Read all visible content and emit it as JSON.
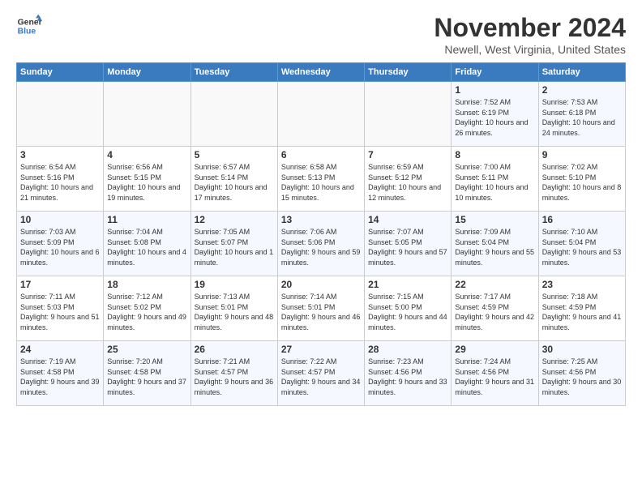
{
  "logo": {
    "line1": "General",
    "line2": "Blue"
  },
  "title": "November 2024",
  "location": "Newell, West Virginia, United States",
  "days_of_week": [
    "Sunday",
    "Monday",
    "Tuesday",
    "Wednesday",
    "Thursday",
    "Friday",
    "Saturday"
  ],
  "weeks": [
    [
      {
        "day": "",
        "info": ""
      },
      {
        "day": "",
        "info": ""
      },
      {
        "day": "",
        "info": ""
      },
      {
        "day": "",
        "info": ""
      },
      {
        "day": "",
        "info": ""
      },
      {
        "day": "1",
        "info": "Sunrise: 7:52 AM\nSunset: 6:19 PM\nDaylight: 10 hours and 26 minutes."
      },
      {
        "day": "2",
        "info": "Sunrise: 7:53 AM\nSunset: 6:18 PM\nDaylight: 10 hours and 24 minutes."
      }
    ],
    [
      {
        "day": "3",
        "info": "Sunrise: 6:54 AM\nSunset: 5:16 PM\nDaylight: 10 hours and 21 minutes."
      },
      {
        "day": "4",
        "info": "Sunrise: 6:56 AM\nSunset: 5:15 PM\nDaylight: 10 hours and 19 minutes."
      },
      {
        "day": "5",
        "info": "Sunrise: 6:57 AM\nSunset: 5:14 PM\nDaylight: 10 hours and 17 minutes."
      },
      {
        "day": "6",
        "info": "Sunrise: 6:58 AM\nSunset: 5:13 PM\nDaylight: 10 hours and 15 minutes."
      },
      {
        "day": "7",
        "info": "Sunrise: 6:59 AM\nSunset: 5:12 PM\nDaylight: 10 hours and 12 minutes."
      },
      {
        "day": "8",
        "info": "Sunrise: 7:00 AM\nSunset: 5:11 PM\nDaylight: 10 hours and 10 minutes."
      },
      {
        "day": "9",
        "info": "Sunrise: 7:02 AM\nSunset: 5:10 PM\nDaylight: 10 hours and 8 minutes."
      }
    ],
    [
      {
        "day": "10",
        "info": "Sunrise: 7:03 AM\nSunset: 5:09 PM\nDaylight: 10 hours and 6 minutes."
      },
      {
        "day": "11",
        "info": "Sunrise: 7:04 AM\nSunset: 5:08 PM\nDaylight: 10 hours and 4 minutes."
      },
      {
        "day": "12",
        "info": "Sunrise: 7:05 AM\nSunset: 5:07 PM\nDaylight: 10 hours and 1 minute."
      },
      {
        "day": "13",
        "info": "Sunrise: 7:06 AM\nSunset: 5:06 PM\nDaylight: 9 hours and 59 minutes."
      },
      {
        "day": "14",
        "info": "Sunrise: 7:07 AM\nSunset: 5:05 PM\nDaylight: 9 hours and 57 minutes."
      },
      {
        "day": "15",
        "info": "Sunrise: 7:09 AM\nSunset: 5:04 PM\nDaylight: 9 hours and 55 minutes."
      },
      {
        "day": "16",
        "info": "Sunrise: 7:10 AM\nSunset: 5:04 PM\nDaylight: 9 hours and 53 minutes."
      }
    ],
    [
      {
        "day": "17",
        "info": "Sunrise: 7:11 AM\nSunset: 5:03 PM\nDaylight: 9 hours and 51 minutes."
      },
      {
        "day": "18",
        "info": "Sunrise: 7:12 AM\nSunset: 5:02 PM\nDaylight: 9 hours and 49 minutes."
      },
      {
        "day": "19",
        "info": "Sunrise: 7:13 AM\nSunset: 5:01 PM\nDaylight: 9 hours and 48 minutes."
      },
      {
        "day": "20",
        "info": "Sunrise: 7:14 AM\nSunset: 5:01 PM\nDaylight: 9 hours and 46 minutes."
      },
      {
        "day": "21",
        "info": "Sunrise: 7:15 AM\nSunset: 5:00 PM\nDaylight: 9 hours and 44 minutes."
      },
      {
        "day": "22",
        "info": "Sunrise: 7:17 AM\nSunset: 4:59 PM\nDaylight: 9 hours and 42 minutes."
      },
      {
        "day": "23",
        "info": "Sunrise: 7:18 AM\nSunset: 4:59 PM\nDaylight: 9 hours and 41 minutes."
      }
    ],
    [
      {
        "day": "24",
        "info": "Sunrise: 7:19 AM\nSunset: 4:58 PM\nDaylight: 9 hours and 39 minutes."
      },
      {
        "day": "25",
        "info": "Sunrise: 7:20 AM\nSunset: 4:58 PM\nDaylight: 9 hours and 37 minutes."
      },
      {
        "day": "26",
        "info": "Sunrise: 7:21 AM\nSunset: 4:57 PM\nDaylight: 9 hours and 36 minutes."
      },
      {
        "day": "27",
        "info": "Sunrise: 7:22 AM\nSunset: 4:57 PM\nDaylight: 9 hours and 34 minutes."
      },
      {
        "day": "28",
        "info": "Sunrise: 7:23 AM\nSunset: 4:56 PM\nDaylight: 9 hours and 33 minutes."
      },
      {
        "day": "29",
        "info": "Sunrise: 7:24 AM\nSunset: 4:56 PM\nDaylight: 9 hours and 31 minutes."
      },
      {
        "day": "30",
        "info": "Sunrise: 7:25 AM\nSunset: 4:56 PM\nDaylight: 9 hours and 30 minutes."
      }
    ]
  ]
}
